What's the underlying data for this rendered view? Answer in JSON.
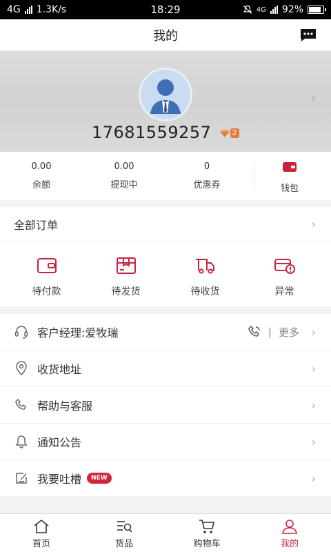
{
  "status_bar": {
    "network": "4G",
    "speed": "1.3K/s",
    "time": "18:29",
    "net_right": "4G",
    "battery": "92%",
    "battery_level": 0.92
  },
  "header": {
    "title": "我的"
  },
  "profile": {
    "phone": "17681559257",
    "vip_level": "2"
  },
  "stats": {
    "items": [
      {
        "value": "0.00",
        "label": "余额"
      },
      {
        "value": "0.00",
        "label": "提现中"
      },
      {
        "value": "0",
        "label": "优惠券"
      }
    ],
    "wallet_label": "钱包"
  },
  "orders": {
    "title": "全部订单",
    "items": [
      {
        "label": "待付款",
        "icon": "wallet-icon"
      },
      {
        "label": "待发货",
        "icon": "box-icon"
      },
      {
        "label": "待收货",
        "icon": "truck-icon"
      },
      {
        "label": "异常",
        "icon": "exception-icon"
      }
    ]
  },
  "menu": {
    "manager": {
      "label": "客户经理:爱牧瑞",
      "more": "更多",
      "separator": "|"
    },
    "address": {
      "label": "收货地址"
    },
    "help": {
      "label": "帮助与客服"
    },
    "notice": {
      "label": "通知公告"
    },
    "feedback": {
      "label": "我要吐槽",
      "badge": "NEW"
    }
  },
  "tabbar": {
    "items": [
      {
        "label": "首页",
        "icon": "home-icon"
      },
      {
        "label": "货品",
        "icon": "search-list-icon"
      },
      {
        "label": "购物车",
        "icon": "cart-icon"
      },
      {
        "label": "我的",
        "icon": "user-icon"
      }
    ]
  },
  "colors": {
    "accent": "#c8233c",
    "badge": "#d2233c"
  }
}
